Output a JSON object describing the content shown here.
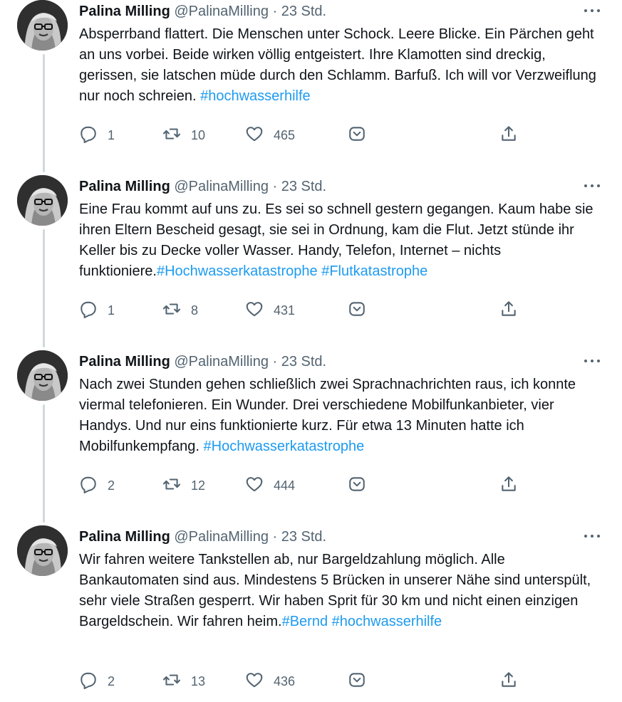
{
  "author": {
    "name": "Palina Milling",
    "handle": "@PalinaMilling",
    "time": "· 23 Std."
  },
  "colors": {
    "link": "#1d9bf0",
    "meta": "#536471",
    "thread_line": "#cfd9de"
  },
  "icons": [
    "more-icon",
    "reply-icon",
    "retweet-icon",
    "like-icon",
    "save-icon",
    "share-icon"
  ],
  "tweets": [
    {
      "segments": [
        {
          "text": "Absperrband flattert. Die Menschen unter Schock. Leere Blicke. Ein Pärchen geht an uns vorbei. Beide wirken völlig entgeistert. Ihre Klamotten sind dreckig, gerissen, sie latschen müde durch den Schlamm. Barfuß. Ich will vor Verzweiflung nur noch schreien.  "
        },
        {
          "tag": "#hochwasserhilfe"
        }
      ],
      "replies": "1",
      "retweets": "10",
      "likes": "465"
    },
    {
      "segments": [
        {
          "text": "Eine Frau kommt auf uns zu. Es sei so schnell gestern gegangen. Kaum habe sie ihren Eltern Bescheid gesagt, sie sei in Ordnung, kam die Flut. Jetzt stünde ihr Keller bis zu Decke voller Wasser. Handy, Telefon, Internet – nichts funktioniere."
        },
        {
          "tag": "#Hochwasserkatastrophe"
        },
        {
          "text": " "
        },
        {
          "tag": "#Flutkatastrophe"
        }
      ],
      "replies": "1",
      "retweets": "8",
      "likes": "431"
    },
    {
      "segments": [
        {
          "text": "Nach zwei Stunden gehen schließlich zwei Sprachnachrichten raus, ich konnte viermal telefonieren. Ein Wunder. Drei verschiedene Mobilfunkanbieter, vier Handys. Und nur eins funktionierte kurz. Für etwa 13 Minuten hatte ich Mobilfunkempfang. "
        },
        {
          "tag": "#Hochwasserkatastrophe"
        }
      ],
      "replies": "2",
      "retweets": "12",
      "likes": "444"
    },
    {
      "segments": [
        {
          "text": "Wir fahren weitere Tankstellen ab, nur Bargeldzahlung möglich. Alle Bankautomaten sind aus. Mindestens 5 Brücken in unserer Nähe sind unterspült, sehr viele Straßen gesperrt. Wir haben Sprit für 30 km und nicht einen einzigen Bargeldschein. Wir fahren heim."
        },
        {
          "tag": "#Bernd"
        },
        {
          "text": " "
        },
        {
          "tag": "#hochwasserhilfe"
        }
      ],
      "replies": "2",
      "retweets": "13",
      "likes": "436"
    }
  ]
}
